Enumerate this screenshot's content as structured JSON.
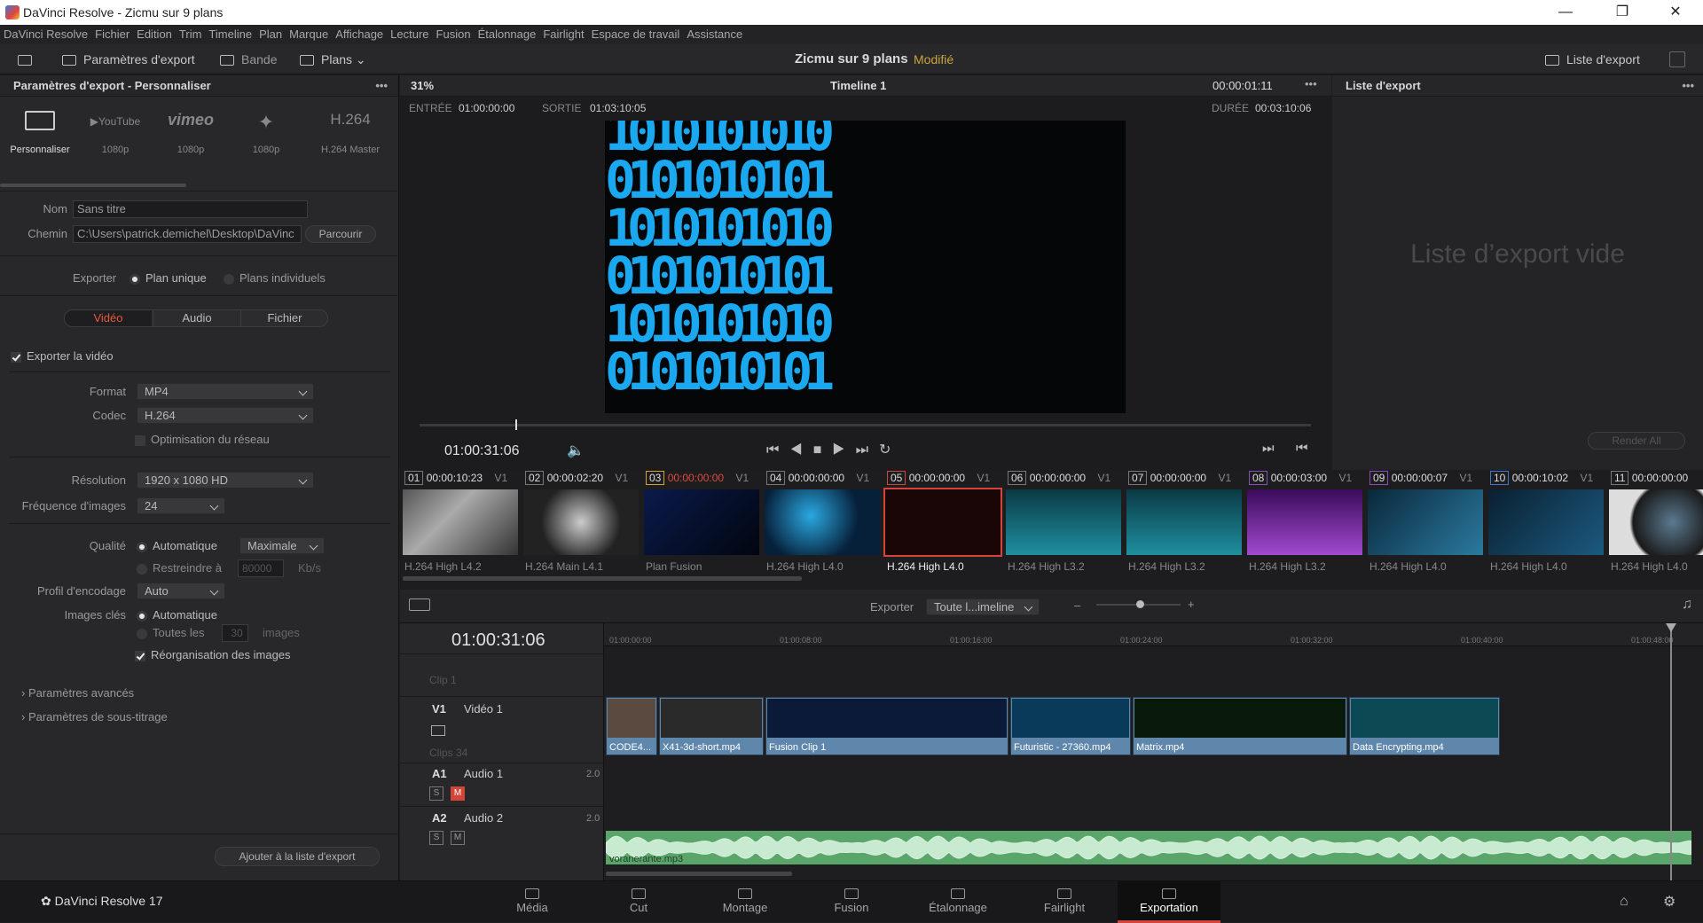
{
  "window": {
    "title": "DaVinci Resolve - Zicmu sur 9 plans"
  },
  "menu": [
    "DaVinci Resolve",
    "Fichier",
    "Edition",
    "Trim",
    "Timeline",
    "Plan",
    "Marque",
    "Affichage",
    "Lecture",
    "Fusion",
    "Étalonnage",
    "Fairlight",
    "Espace de travail",
    "Assistance"
  ],
  "toolbar": {
    "export_settings": "Paramètres d'export",
    "tape": "Bande",
    "clips": "Plans",
    "project": "Zicmu sur 9 plans",
    "modified": "Modifié",
    "export_list": "Liste d'export"
  },
  "left_panel": {
    "header": "Paramètres d'export - Personnaliser",
    "presets": [
      {
        "icon": "film-icon",
        "name": "",
        "sub": "Personnaliser"
      },
      {
        "icon": "youtube-icon",
        "name": "YouTube",
        "sub": "1080p"
      },
      {
        "icon": "vimeo-icon",
        "name": "vimeo",
        "sub": "1080p"
      },
      {
        "icon": "twitter-icon",
        "name": "",
        "sub": "1080p"
      },
      {
        "icon": "h264-icon",
        "name": "H.264",
        "sub": "H.264 Master"
      }
    ],
    "name_label": "Nom",
    "name_value": "Sans titre",
    "path_label": "Chemin",
    "path_value": "C:\\Users\\patrick.demichel\\Desktop\\DaVinc",
    "browse": "Parcourir",
    "export_label": "Exporter",
    "single": "Plan unique",
    "individual": "Plans individuels",
    "tabs": [
      "Vidéo",
      "Audio",
      "Fichier"
    ],
    "export_video": "Exporter la vidéo",
    "format_label": "Format",
    "format_value": "MP4",
    "codec_label": "Codec",
    "codec_value": "H.264",
    "network_opt": "Optimisation du réseau",
    "resolution_label": "Résolution",
    "resolution_value": "1920 x 1080 HD",
    "fps_label": "Fréquence d'images",
    "fps_value": "24",
    "quality_label": "Qualité",
    "quality_auto": "Automatique",
    "quality_value": "Maximale",
    "restrict": "Restreindre à",
    "restrict_value": "80000",
    "restrict_unit": "Kb/s",
    "profile_label": "Profil d'encodage",
    "profile_value": "Auto",
    "keyframes_label": "Images clés",
    "key_auto": "Automatique",
    "key_every": "Toutes les",
    "key_value": "30",
    "key_unit": "images",
    "reorder": "Réorganisation des images",
    "advanced": "Paramètres avancés",
    "subtitles": "Paramètres de sous-titrage",
    "add_btn": "Ajouter à la liste d'export"
  },
  "viewer": {
    "zoom": "31%",
    "timeline": "Timeline 1",
    "tc_top": "00:00:01:11",
    "in_label": "ENTRÉE",
    "in_value": "01:00:00:00",
    "out_label": "SORTIE",
    "out_value": "01:03:10:05",
    "dur_label": "DURÉE",
    "dur_value": "00:03:10:06",
    "timecode": "01:00:31:06",
    "binary_rows": [
      "1010101010",
      "0101010101",
      "1010101010",
      "0101010101",
      "1010101010",
      "0101010101"
    ]
  },
  "right_panel": {
    "header": "Liste d'export",
    "empty": "Liste d’export vide",
    "render": "Render All"
  },
  "clips": [
    {
      "n": "01",
      "tc": "00:00:10:23",
      "v": "V1",
      "codec": "H.264 High L4.2"
    },
    {
      "n": "02",
      "tc": "00:00:02:20",
      "v": "V1",
      "codec": "H.264 Main L4.1"
    },
    {
      "n": "03",
      "tc": "00:00:00:00",
      "v": "V1",
      "codec": "Plan Fusion"
    },
    {
      "n": "04",
      "tc": "00:00:00:00",
      "v": "V1",
      "codec": "H.264 High L4.0"
    },
    {
      "n": "05",
      "tc": "00:00:00:00",
      "v": "V1",
      "codec": "H.264 High L4.0"
    },
    {
      "n": "06",
      "tc": "00:00:00:00",
      "v": "V1",
      "codec": "H.264 High L3.2"
    },
    {
      "n": "07",
      "tc": "00:00:00:00",
      "v": "V1",
      "codec": "H.264 High L3.2"
    },
    {
      "n": "08",
      "tc": "00:00:03:00",
      "v": "V1",
      "codec": "H.264 High L3.2"
    },
    {
      "n": "09",
      "tc": "00:00:00:07",
      "v": "V1",
      "codec": "H.264 High L4.0"
    },
    {
      "n": "10",
      "tc": "00:00:10:02",
      "v": "V1",
      "codec": "H.264 High L4.0"
    },
    {
      "n": "11",
      "tc": "00:00:00:00",
      "v": "",
      "codec": "H.264 High L4.0"
    }
  ],
  "timeline": {
    "export_label": "Exporter",
    "range": "Toute l...imeline",
    "timecode": "01:00:31:06",
    "ruler": [
      "01:00:00:00",
      "01:00:08:00",
      "01:00:16:00",
      "01:00:24:00",
      "01:00:32:00",
      "01:00:40:00",
      "01:00:48:00"
    ],
    "clip1_label": "Clip 1",
    "v1": "V1",
    "v1_name": "Vidéo 1",
    "clips_count": "Clips 34",
    "a1": "A1",
    "a1_name": "Audio 1",
    "a1_ch": "2.0",
    "a2": "A2",
    "a2_name": "Audio 2",
    "a2_ch": "2.0",
    "s": "S",
    "m": "M",
    "video_clips": [
      "CODE4...",
      "X41-3d-short.mp4",
      "Fusion Clip 1",
      "Futuristic - 27360.mp4",
      "Matrix.mp4",
      "Data Encrypting.mp4"
    ],
    "audio_clip": "voranerante.mp3"
  },
  "pages": [
    "Média",
    "Cut",
    "Montage",
    "Fusion",
    "Étalonnage",
    "Fairlight",
    "Exportation"
  ],
  "brand": "DaVinci Resolve 17"
}
